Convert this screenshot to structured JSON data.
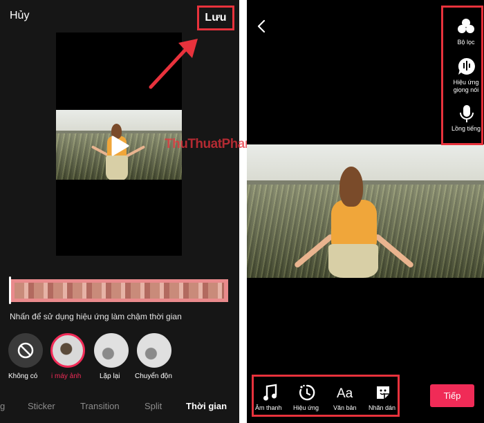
{
  "left": {
    "cancel_label": "Hủy",
    "save_label": "Lưu",
    "hint": "Nhấn để sử dụng hiệu ứng làm chậm thời gian",
    "effects": [
      {
        "label": "Không có",
        "icon": "no-effect-icon",
        "selected": false
      },
      {
        "label": "i máy ảnh",
        "icon": "camera-effect-thumb",
        "selected": true
      },
      {
        "label": "Lặp lại",
        "icon": "repeat-effect-thumb",
        "selected": false
      },
      {
        "label": "Chuyển độn",
        "icon": "motion-effect-thumb",
        "selected": false
      }
    ],
    "tabs": [
      "g",
      "Sticker",
      "Transition",
      "Split",
      "Thời gian"
    ],
    "active_tab": "Thời gian"
  },
  "right": {
    "tools": [
      {
        "label": "Bộ lọc",
        "icon": "filter-icon"
      },
      {
        "label": "Hiệu ứng\ngiọng nói",
        "icon": "voice-effect-icon"
      },
      {
        "label": "Lồng tiếng",
        "icon": "microphone-icon"
      }
    ],
    "bottom_tools": [
      {
        "label": "Âm thanh",
        "icon": "music-note-icon"
      },
      {
        "label": "Hiệu ứng",
        "icon": "effect-timer-icon"
      },
      {
        "label": "Văn bản",
        "icon": "text-icon"
      },
      {
        "label": "Nhãn dán",
        "icon": "sticker-icon"
      }
    ],
    "next_label": "Tiếp"
  },
  "watermark": "ThuThuatPhanMem.vn",
  "colors": {
    "highlight": "#e8323c",
    "accent": "#f02b57",
    "timeline": "#e98a8c"
  }
}
